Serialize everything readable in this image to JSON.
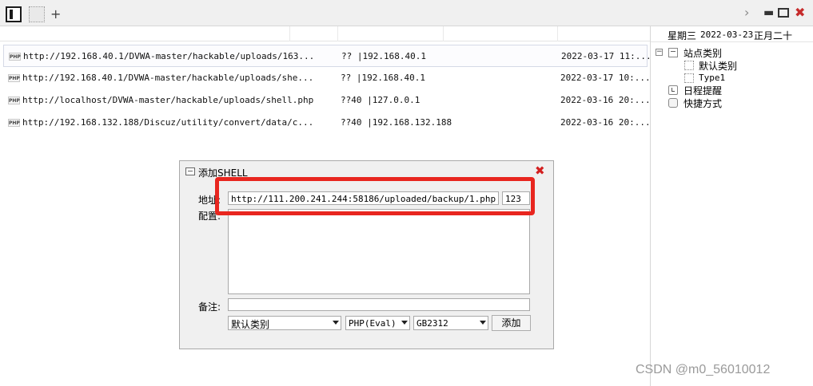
{
  "topbar": {
    "add_tab_label": "+",
    "next_label": "›",
    "minimize_label": "▬",
    "close_label": "✖"
  },
  "shell_list": {
    "rows": [
      {
        "icon": "PHP",
        "url": "http://192.168.40.1/DVWA-master/hackable/uploads/163...",
        "ip": "?? |192.168.40.1",
        "time": "2022-03-17 11:..."
      },
      {
        "icon": "PHP",
        "url": "http://192.168.40.1/DVWA-master/hackable/uploads/she...",
        "ip": "?? |192.168.40.1",
        "time": "2022-03-17 10:..."
      },
      {
        "icon": "PHP",
        "url": "http://localhost/DVWA-master/hackable/uploads/shell.php",
        "ip": "??40 |127.0.0.1",
        "time": "2022-03-16 20:..."
      },
      {
        "icon": "PHP",
        "url": "http://192.168.132.188/Discuz/utility/convert/data/c...",
        "ip": "??40 |192.168.132.188",
        "time": "2022-03-16 20:..."
      }
    ]
  },
  "right_panel": {
    "weekday": "星期三",
    "date": "2022-03-23",
    "lunar": "正月二十",
    "tree": {
      "toggle": "−",
      "site_category": "站点类别",
      "default_category": "默认类别",
      "type1": "Type1",
      "schedule": "日程提醒",
      "shortcuts": "快捷方式"
    }
  },
  "dialog": {
    "title": "添加SHELL",
    "close_label": "✖",
    "address_label": "地址:",
    "config_label": "配置:",
    "note_label": "备注:",
    "url_value": "http://111.200.241.244:58186/uploaded/backup/1.php",
    "password_value": "123",
    "config_value": "",
    "note_value": "",
    "category_select": "默认类别",
    "script_select": "PHP(Eval)",
    "encoding_select": "GB2312",
    "add_button": "添加"
  },
  "watermark": "CSDN @m0_56010012",
  "colors": {
    "highlight": "#e8261f",
    "dialog_close": "#d32020"
  }
}
